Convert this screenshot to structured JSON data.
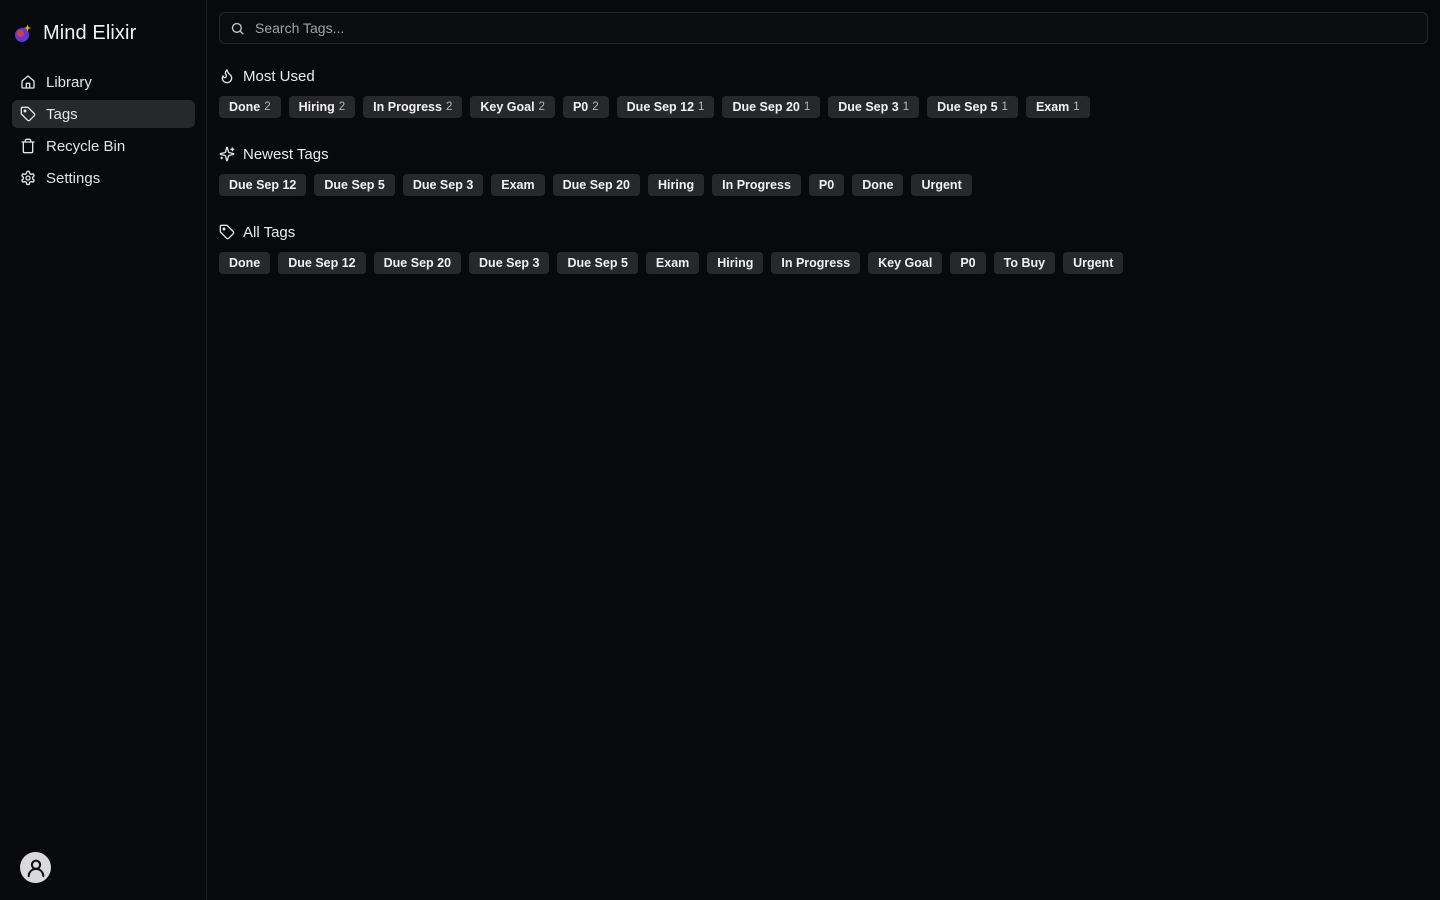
{
  "app": {
    "name": "Mind Elixir"
  },
  "sidebar": {
    "items": [
      {
        "label": "Library",
        "icon": "home-icon"
      },
      {
        "label": "Tags",
        "icon": "tag-icon",
        "active": true
      },
      {
        "label": "Recycle Bin",
        "icon": "trash-icon"
      },
      {
        "label": "Settings",
        "icon": "gear-icon"
      }
    ]
  },
  "search": {
    "placeholder": "Search Tags..."
  },
  "sections": {
    "most_used": {
      "title": "Most Used",
      "icon": "flame-icon",
      "tags": [
        {
          "label": "Done",
          "count": "2"
        },
        {
          "label": "Hiring",
          "count": "2"
        },
        {
          "label": "In Progress",
          "count": "2"
        },
        {
          "label": "Key Goal",
          "count": "2"
        },
        {
          "label": "P0",
          "count": "2"
        },
        {
          "label": "Due Sep 12",
          "count": "1"
        },
        {
          "label": "Due Sep 20",
          "count": "1"
        },
        {
          "label": "Due Sep 3",
          "count": "1"
        },
        {
          "label": "Due Sep 5",
          "count": "1"
        },
        {
          "label": "Exam",
          "count": "1"
        }
      ]
    },
    "newest": {
      "title": "Newest Tags",
      "icon": "sparkles-icon",
      "tags": [
        {
          "label": "Due Sep 12"
        },
        {
          "label": "Due Sep 5"
        },
        {
          "label": "Due Sep 3"
        },
        {
          "label": "Exam"
        },
        {
          "label": "Due Sep 20"
        },
        {
          "label": "Hiring"
        },
        {
          "label": "In Progress"
        },
        {
          "label": "P0"
        },
        {
          "label": "Done"
        },
        {
          "label": "Urgent"
        }
      ]
    },
    "all": {
      "title": "All Tags",
      "icon": "tag-icon",
      "tags": [
        {
          "label": "Done"
        },
        {
          "label": "Due Sep 12"
        },
        {
          "label": "Due Sep 20"
        },
        {
          "label": "Due Sep 3"
        },
        {
          "label": "Due Sep 5"
        },
        {
          "label": "Exam"
        },
        {
          "label": "Hiring"
        },
        {
          "label": "In Progress"
        },
        {
          "label": "Key Goal"
        },
        {
          "label": "P0"
        },
        {
          "label": "To Buy"
        },
        {
          "label": "Urgent"
        }
      ]
    }
  },
  "colors": {
    "background": "#08090b",
    "sidebar_active": "#27282c",
    "tag_background": "#27282c",
    "border": "#1c1d21"
  }
}
